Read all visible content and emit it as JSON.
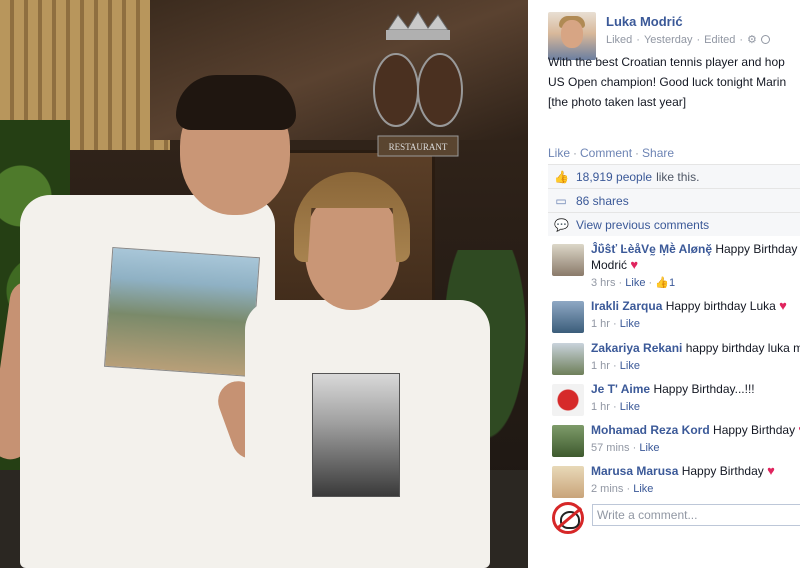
{
  "colors": {
    "link": "#3b5998",
    "muted": "#9197a3",
    "ufi_bg": "#f6f7f9",
    "heart": "#e0245e"
  },
  "photo": {
    "sign_text": "RESTAURANT"
  },
  "post": {
    "author": "Luka Modrić",
    "meta": {
      "liked": "Liked",
      "sep1": "·",
      "time": "Yesterday",
      "sep2": "·",
      "edited": "Edited",
      "sep3": "·"
    },
    "text_lines": [
      "With the best Croatian tennis player and hop",
      "US Open champion! Good luck tonight Marin",
      "[the photo taken last year]"
    ],
    "actions": {
      "like": "Like",
      "comment": "Comment",
      "share": "Share",
      "sep": "·"
    },
    "likes": {
      "count": "18,919 people",
      "suffix": "like this."
    },
    "shares": "86 shares",
    "view_previous": "View previous comments"
  },
  "comments": [
    {
      "name": "Ĵΰŝť ĿèåVḛ Ṃḕ Alønḝ",
      "text": "Happy Birthday L",
      "text2": "Modrić",
      "heart": "♥",
      "time": "3 hrs",
      "like": "Like",
      "likes": "1",
      "sep": "·"
    },
    {
      "name": "Irakli Zarqua",
      "text": "Happy birthday Luka",
      "heart": "♥",
      "time": "1 hr",
      "like": "Like",
      "sep": "·"
    },
    {
      "name": "Zakariya Rekani",
      "text": "happy birthday luka m",
      "time": "1 hr",
      "like": "Like",
      "sep": "·"
    },
    {
      "name": "Je T' Aime",
      "text": "Happy Birthday...!!!",
      "time": "1 hr",
      "like": "Like",
      "sep": "·"
    },
    {
      "name": "Mohamad Reza Kord",
      "text": "Happy Birthday",
      "heart": "♥",
      "time": "57 mins",
      "like": "Like",
      "sep": "·"
    },
    {
      "name": "Marusa Marusa",
      "text": "Happy Birthday",
      "heart": "♥",
      "time": "2 mins",
      "like": "Like",
      "sep": "·"
    }
  ],
  "composer": {
    "placeholder": "Write a comment..."
  }
}
